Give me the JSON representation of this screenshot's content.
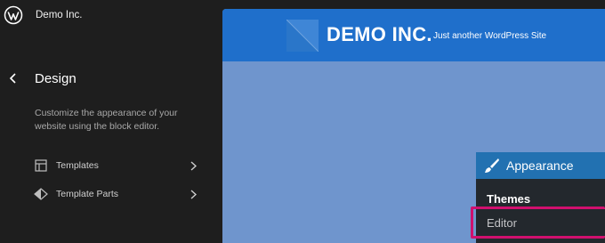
{
  "sidebar": {
    "site_name": "Demo Inc.",
    "title": "Design",
    "description": "Customize the appearance of your website using the block editor.",
    "items": [
      {
        "label": "Templates",
        "icon": "layout-icon"
      },
      {
        "label": "Template Parts",
        "icon": "symbol-icon"
      }
    ]
  },
  "preview": {
    "site_title": "DEMO INC.",
    "tagline": "Just another WordPress Site",
    "colors": {
      "header": "#1f6fcb",
      "body": "#6f95cd"
    }
  },
  "admin_menu": {
    "section": "Appearance",
    "items": [
      "Themes",
      "Editor"
    ],
    "highlighted": "Editor",
    "colors": {
      "accent": "#2271b1",
      "highlight": "#d0106e",
      "background": "#23282d"
    }
  }
}
